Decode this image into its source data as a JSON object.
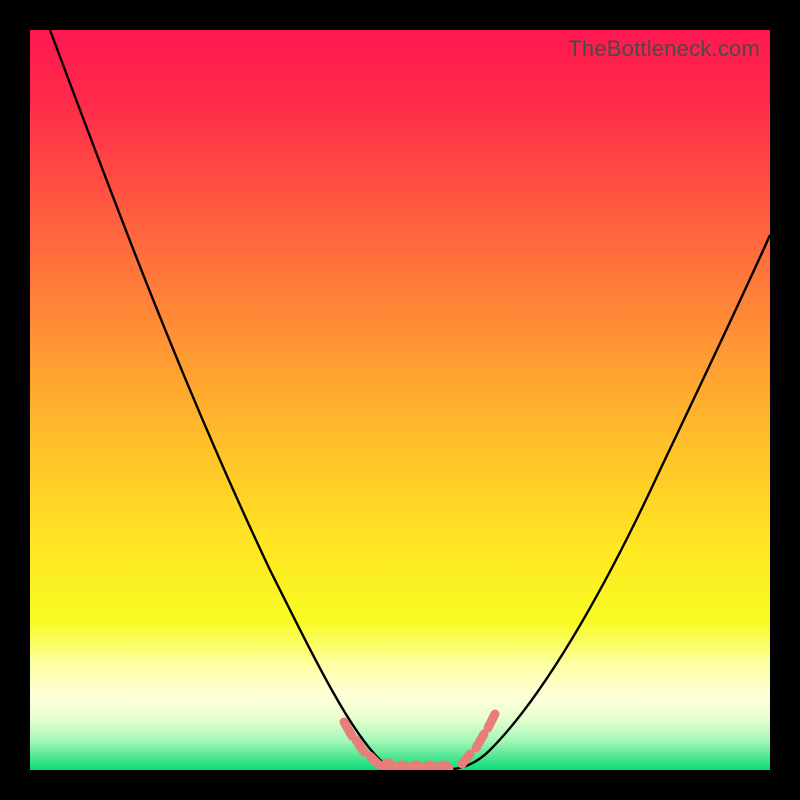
{
  "watermark": "TheBottleneck.com",
  "chart_data": {
    "type": "line",
    "title": "",
    "xlabel": "",
    "ylabel": "",
    "xlim": [
      0,
      100
    ],
    "ylim": [
      0,
      100
    ],
    "grid": false,
    "legend": false,
    "series": [
      {
        "name": "left-curve",
        "x": [
          0,
          5,
          10,
          15,
          20,
          25,
          30,
          35,
          40,
          44,
          47,
          50
        ],
        "y": [
          100,
          89,
          78,
          67,
          56,
          45,
          34,
          23,
          12,
          4,
          1,
          0
        ]
      },
      {
        "name": "right-curve",
        "x": [
          55,
          58,
          62,
          66,
          70,
          75,
          80,
          85,
          90,
          95,
          100
        ],
        "y": [
          0,
          2,
          6,
          11,
          17,
          25,
          34,
          44,
          54,
          64,
          72
        ]
      },
      {
        "name": "valley-markers",
        "type": "scatter",
        "x": [
          42,
          44,
          46,
          48,
          50,
          52,
          54,
          57,
          59,
          61
        ],
        "y": [
          6,
          3,
          1,
          0,
          0,
          0,
          0,
          2,
          5,
          8
        ]
      }
    ],
    "colors": {
      "curve": "#000000",
      "marker": "#e77e79",
      "gradient_stops": [
        {
          "offset": 0.0,
          "color": "#ff1850"
        },
        {
          "offset": 0.1,
          "color": "#ff2b4a"
        },
        {
          "offset": 0.25,
          "color": "#ff5d3f"
        },
        {
          "offset": 0.4,
          "color": "#ff8d35"
        },
        {
          "offset": 0.55,
          "color": "#ffbd2b"
        },
        {
          "offset": 0.7,
          "color": "#ffe722"
        },
        {
          "offset": 0.8,
          "color": "#f8fb24"
        },
        {
          "offset": 0.86,
          "color": "#fdffa8"
        },
        {
          "offset": 0.9,
          "color": "#ffffd8"
        },
        {
          "offset": 0.93,
          "color": "#e8ffd0"
        },
        {
          "offset": 0.96,
          "color": "#a6f7b8"
        },
        {
          "offset": 0.985,
          "color": "#45e58e"
        },
        {
          "offset": 1.0,
          "color": "#0bdc7a"
        }
      ]
    }
  }
}
